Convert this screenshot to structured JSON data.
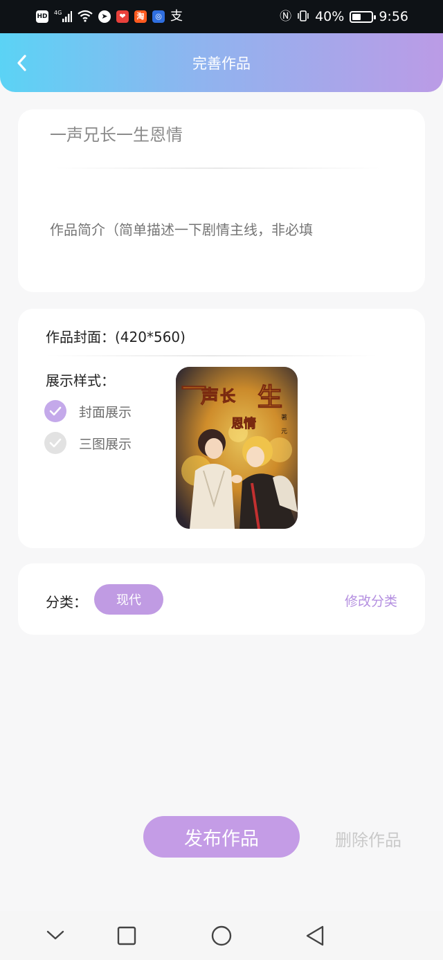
{
  "status_bar": {
    "left_icons": [
      "hd-icon",
      "4g-signal-icon",
      "wifi-icon",
      "app-icon",
      "app-icon",
      "taobao-icon",
      "bulb-icon",
      "alipay-icon"
    ],
    "network": "4G",
    "battery": "40%",
    "battery_level": 0.4,
    "time": "9:56"
  },
  "header": {
    "title": "完善作品"
  },
  "work": {
    "title_value": "一声兄长一生恩情",
    "intro_placeholder": "作品简介（简单描述一下剧情主线，非必填"
  },
  "cover": {
    "label": "作品封面：(420*560)",
    "style_label": "展示样式：",
    "options": [
      {
        "label": "封面展示",
        "checked": true
      },
      {
        "label": "三图展示",
        "checked": false
      }
    ],
    "image_title_text": "一声长一生恩情"
  },
  "category": {
    "label": "分类：",
    "value": "现代",
    "edit_label": "修改分类"
  },
  "actions": {
    "publish_label": "发布作品",
    "delete_label": "删除作品"
  },
  "colors": {
    "accent": "#c49ce6",
    "header_start": "#5bd3f5",
    "header_end": "#bb9be6",
    "check_on": "#c4a9ea"
  }
}
